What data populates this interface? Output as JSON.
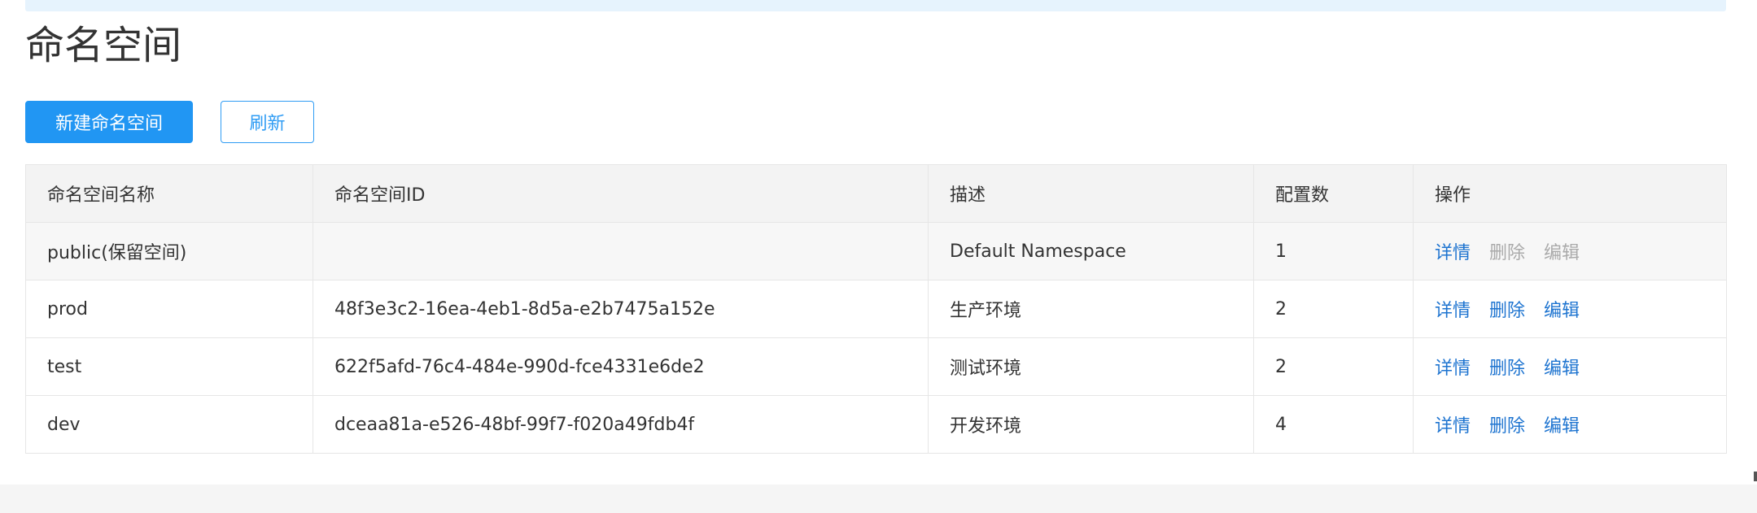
{
  "page": {
    "title": "命名空间"
  },
  "toolbar": {
    "create_label": "新建命名空间",
    "refresh_label": "刷新"
  },
  "table": {
    "columns": [
      "命名空间名称",
      "命名空间ID",
      "描述",
      "配置数",
      "操作"
    ],
    "rows": [
      {
        "name": "public(保留空间)",
        "id": "",
        "desc": "Default Namespace",
        "count": "1",
        "ops_disabled": true
      },
      {
        "name": "prod",
        "id": "48f3e3c2-16ea-4eb1-8d5a-e2b7475a152e",
        "desc": "生产环境",
        "count": "2",
        "ops_disabled": false
      },
      {
        "name": "test",
        "id": "622f5afd-76c4-484e-990d-fce4331e6de2",
        "desc": "测试环境",
        "count": "2",
        "ops_disabled": false
      },
      {
        "name": "dev",
        "id": "dceaa81a-e526-48bf-99f7-f020a49fdb4f",
        "desc": "开发环境",
        "count": "4",
        "ops_disabled": false
      }
    ],
    "actions": {
      "detail": "详情",
      "delete": "删除",
      "edit": "编辑"
    }
  },
  "colors": {
    "primary": "#2196f3",
    "link": "#1e74d0",
    "link_disabled": "#aaaaaa",
    "banner": "#e6f3fd",
    "header_bg": "#f3f3f3"
  }
}
